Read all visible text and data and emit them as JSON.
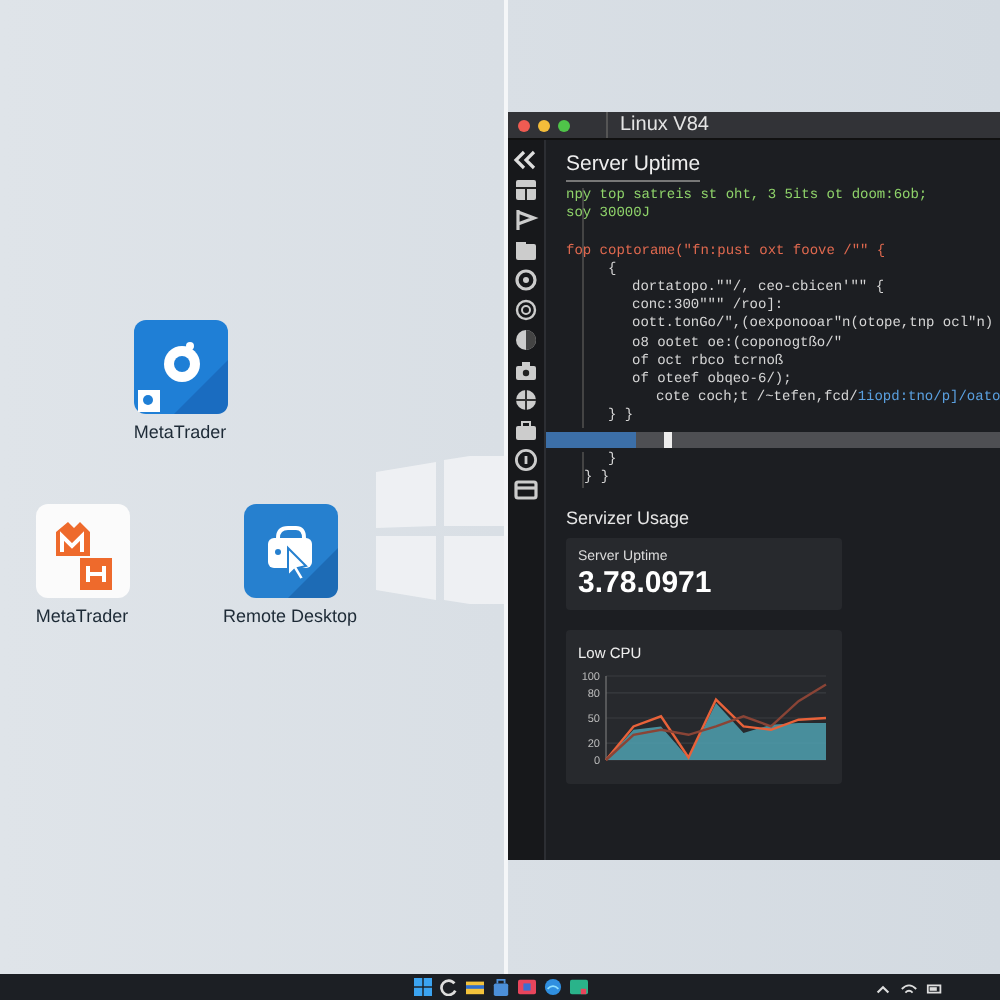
{
  "desktop_icons": [
    {
      "label": "MetaTrader",
      "kind": "blue"
    },
    {
      "label": "MetaTrader",
      "kind": "orange"
    },
    {
      "label": "Remote Desktop",
      "kind": "remote"
    }
  ],
  "window": {
    "title": "Linux V84",
    "heading": "Server Uptime",
    "code_lines": [
      {
        "kind": "code",
        "segments": [
          {
            "text": "npy top satreis st oht, 3 5its ot doom:6ob;",
            "kind": "comment"
          }
        ]
      },
      {
        "kind": "code",
        "segments": [
          {
            "text": "soy 30000J",
            "kind": "comment"
          }
        ]
      },
      {
        "kind": "blank"
      },
      {
        "kind": "code",
        "segments": [
          {
            "text": "fop coptorame(\"fn:pust oxt foove /\"\" {",
            "kind": "keyword"
          }
        ],
        "children": [
          {
            "kind": "code",
            "segments": [
              {
                "text": "{",
                "kind": "plain"
              }
            ],
            "children": [
              {
                "kind": "code",
                "segments": [
                  {
                    "text": "dortatopo.\"\"/, ceo-cbicen'\"\" {",
                    "kind": "plain"
                  }
                ]
              },
              {
                "kind": "code",
                "segments": [
                  {
                    "text": "conc:300\"\"\" /roo]:",
                    "kind": "plain"
                  }
                ]
              },
              {
                "kind": "code",
                "segments": [
                  {
                    "text": "oott.tonGo/\",(oexponooar\"n(otope,tnp ocl\"n)",
                    "kind": "plain"
                  }
                ]
              },
              {
                "kind": "code",
                "segments": [
                  {
                    "text": "o8 ootet oe:(coponogtßo/\"",
                    "kind": "plain"
                  }
                ]
              },
              {
                "kind": "code",
                "segments": [
                  {
                    "text": "of oct rbco tcrnoß",
                    "kind": "plain"
                  }
                ]
              },
              {
                "kind": "code",
                "segments": [
                  {
                    "text": "of oteef obqeo-6/);",
                    "kind": "plain"
                  }
                ],
                "children": [
                  {
                    "kind": "code",
                    "segments": [
                      {
                        "text": "cote coch;t /~tefen,fcd/",
                        "kind": "plain"
                      },
                      {
                        "text": "1iopd:tno/p]/oato",
                        "kind": "string"
                      }
                    ]
                  }
                ]
              }
            ]
          },
          {
            "kind": "code",
            "segments": [
              {
                "text": "} }",
                "kind": "plain"
              }
            ]
          }
        ]
      }
    ],
    "code_after": [
      {
        "kind": "group",
        "children": [
          {
            "kind": "code",
            "segments": [
              {
                "text": "}",
                "kind": "plain"
              }
            ]
          }
        ]
      },
      {
        "kind": "code",
        "segments": [
          {
            "text": "} }",
            "kind": "plain"
          }
        ]
      }
    ],
    "section_title": "Servizer Usage",
    "stat": {
      "label": "Server Uptime",
      "value": "3.78.0971"
    },
    "chart_data": {
      "type": "area",
      "title": "Low CPU",
      "grid": true,
      "ylim": [
        0,
        100
      ],
      "yticks": [
        0,
        20,
        50,
        80,
        100
      ],
      "series": [
        {
          "type": "area",
          "color": "#4fa0b0",
          "values": [
            0,
            36,
            40,
            2,
            68,
            32,
            42,
            44,
            44
          ]
        },
        {
          "type": "line",
          "color": "#e8623a",
          "values": [
            0,
            40,
            52,
            3,
            72,
            40,
            36,
            48,
            50
          ]
        },
        {
          "type": "line",
          "color": "#8a4436",
          "values": [
            0,
            30,
            36,
            30,
            40,
            52,
            40,
            70,
            90
          ]
        }
      ]
    }
  }
}
